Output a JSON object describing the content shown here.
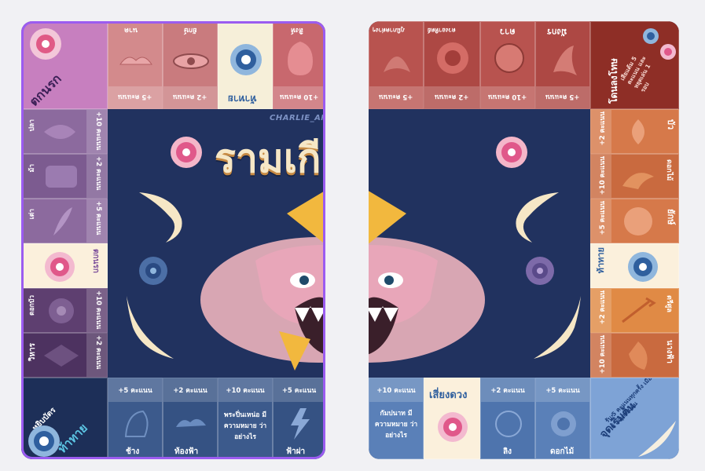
{
  "left_board": {
    "corner_top_left": {
      "label": "ตกนรก"
    },
    "top_row": [
      {
        "label": "นาค",
        "points": "+5 คะแนน"
      },
      {
        "label": "ยักษ์",
        "points": "+2 คะแนน"
      },
      {
        "label": "ท้าทาย"
      },
      {
        "label": "สิงห์",
        "points": "+10 คะแนน"
      }
    ],
    "left_col": [
      {
        "label": "ปลา",
        "points": "+10 คะแนน"
      },
      {
        "label": "ม้า",
        "points": "+2 คะแนน"
      },
      {
        "label": "เต่า",
        "points": "+5 คะแนน"
      },
      {
        "label": "ตกนรก"
      },
      {
        "label": "ดอกบัว",
        "points": "+10 คะแนน"
      },
      {
        "label": "วิหาร",
        "points": "+2 คะแนน"
      }
    ],
    "corner_bottom_left": {
      "label_line1": "หยิบบัตร",
      "label_line2": "ท้าทาย"
    },
    "bottom_row": [
      {
        "label": "ช้าง",
        "points": "+5 คะแนน"
      },
      {
        "label": "ท้องฟ้า",
        "points": "+2 คะแนน"
      },
      {
        "text": "พระปิ่นเหน่อ มีความหมาย ว่าอย่างไร",
        "points": "+10 คะแนน"
      },
      {
        "label": "ฟ้าผ่า",
        "points": "+5 คะแนน"
      }
    ]
  },
  "right_board": {
    "top_row": [
      {
        "label": "ภูมิภาคต่างๆ",
        "points": "+5 คะแนน"
      },
      {
        "label": "ดวงอาทิตย์",
        "points": "+2 คะแนน"
      },
      {
        "label": "ดาว",
        "points": "+10 คะแนน"
      },
      {
        "label": "มังกร",
        "points": "+5 คะแนน"
      }
    ],
    "corner_top_right": {
      "label": "โดนลงโทษ",
      "note": "เสียแต้ม 5 คะแนน และ หยุดเล่น 1 รอบ"
    },
    "right_col": [
      {
        "label": "บัว",
        "points": "+2 คะแนน"
      },
      {
        "label": "ดอกไม้",
        "points": "+10 คะแนน"
      },
      {
        "label": "ยักษ์",
        "points": "+5 คะแนน"
      },
      {
        "label": "ท้าทาย"
      },
      {
        "label": "ตรีศูล",
        "points": "+2 คะแนน"
      },
      {
        "label": "นางฟ้า",
        "points": "+10 คะแนน"
      }
    ],
    "bottom_row": [
      {
        "text": "กัมปนาท มีความหมาย ว่าอย่างไร",
        "points": "+10 คะแนน"
      },
      {
        "label": "เสี่ยงดวง"
      },
      {
        "label": "ลิง",
        "points": "+2 คะแนน"
      },
      {
        "label": "ดอกไม้",
        "points": "+5 คะแนน"
      }
    ],
    "corner_bottom_right": {
      "label": "จุดเริ่มต้น",
      "note": "รับ 5 คะแนนทุกครั้ง เมื่อผ่านจุดเริ่มต้น"
    }
  },
  "center": {
    "title": "รามเกียรติ์",
    "credit": "CHARLIE_AND_ARE_CHERRY"
  },
  "colors": {
    "board_bg": "#21325f",
    "selection": "#9b5cf0",
    "title": "#f6e7c6"
  }
}
